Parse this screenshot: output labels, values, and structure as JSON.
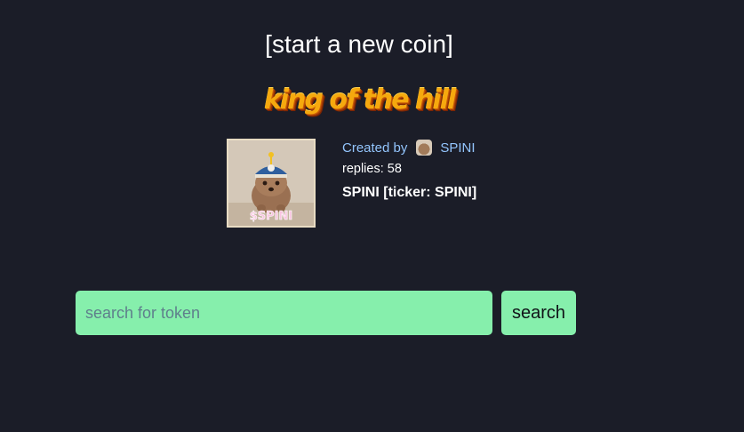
{
  "header": {
    "new_coin_link": "[start a new coin]",
    "koth_banner": "king of the hill"
  },
  "featured_coin": {
    "image_icon": "dog-with-cap-image",
    "image_caption": "$SPINI",
    "created_by_label": "Created by",
    "creator_avatar_icon": "creator-avatar",
    "creator_name": "SPINI",
    "replies_label": "replies:",
    "replies_count": "58",
    "title": "SPINI [ticker: SPINI]"
  },
  "search": {
    "placeholder": "search for token",
    "value": "",
    "button_label": "search"
  },
  "colors": {
    "background": "#1b1d28",
    "accent_green": "#86efac",
    "link_blue": "#93c5fd",
    "banner_orange": "#f6a90e"
  }
}
